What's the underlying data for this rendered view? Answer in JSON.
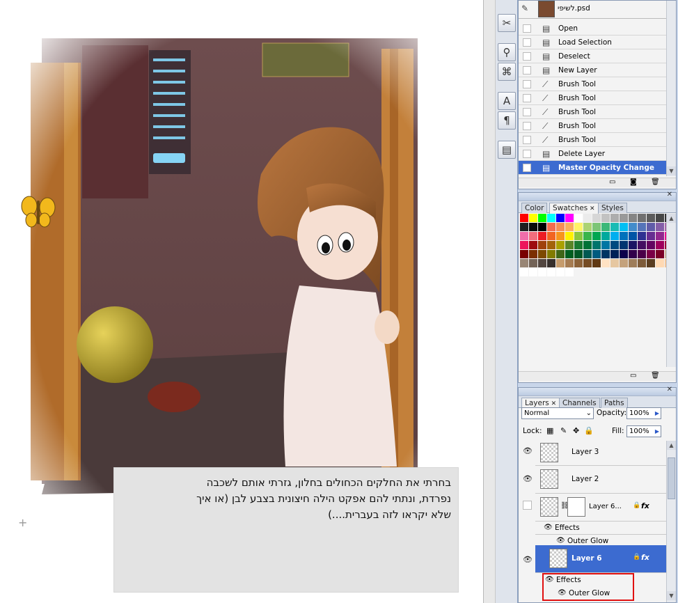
{
  "caption": {
    "line1": "בחרתי את החלקים הכחולים בחלון, גזרתי אותם לשכבה",
    "line2": "נפרדת, ונתתי להם אפקט הילה חיצונית בצבע לבן (או איך",
    "line3": "שלא יקראו לזה בעברית....)"
  },
  "history": {
    "snapshot_label": "לשיפי.psd",
    "items": [
      {
        "label": "Open",
        "icon": "document-icon",
        "selected": false
      },
      {
        "label": "Load Selection",
        "icon": "document-icon",
        "selected": false
      },
      {
        "label": "Deselect",
        "icon": "document-icon",
        "selected": false
      },
      {
        "label": "New Layer",
        "icon": "document-icon",
        "selected": false
      },
      {
        "label": "Brush Tool",
        "icon": "brush-icon",
        "selected": false
      },
      {
        "label": "Brush Tool",
        "icon": "brush-icon",
        "selected": false
      },
      {
        "label": "Brush Tool",
        "icon": "brush-icon",
        "selected": false
      },
      {
        "label": "Brush Tool",
        "icon": "brush-icon",
        "selected": false
      },
      {
        "label": "Brush Tool",
        "icon": "brush-icon",
        "selected": false
      },
      {
        "label": "Delete Layer",
        "icon": "document-icon",
        "selected": false
      },
      {
        "label": "Master Opacity Change",
        "icon": "document-icon",
        "selected": true
      }
    ]
  },
  "color_panel": {
    "tabs": [
      {
        "label": "Color",
        "active": false
      },
      {
        "label": "Swatches",
        "active": true
      },
      {
        "label": "Styles",
        "active": false
      }
    ]
  },
  "swatches": [
    "#ff0000",
    "#ffff00",
    "#00ff00",
    "#00ffff",
    "#0000ff",
    "#ff00ff",
    "#ffffff",
    "#ebebeb",
    "#d6d6d6",
    "#c2c2c2",
    "#adadad",
    "#999999",
    "#858585",
    "#707070",
    "#5c5c5c",
    "#474747",
    "#333333",
    "#1f1f1f",
    "#0a0a0a",
    "#000000",
    "#f26c4f",
    "#f68e56",
    "#fbaf5d",
    "#fff568",
    "#acd372",
    "#7cc576",
    "#3bb878",
    "#1abbb4",
    "#00bff3",
    "#438ccb",
    "#5574b9",
    "#605ca8",
    "#855fa8",
    "#a763a8",
    "#f06eaa",
    "#f26d7d",
    "#ed1c24",
    "#f26522",
    "#f7941d",
    "#fff200",
    "#8dc73f",
    "#39b54a",
    "#00a651",
    "#00a99d",
    "#00aeef",
    "#0072bc",
    "#0054a6",
    "#2e3192",
    "#662d91",
    "#92278f",
    "#ec008c",
    "#ed145b",
    "#9e0b0f",
    "#a0410d",
    "#a3620a",
    "#aba000",
    "#598527",
    "#1a7b30",
    "#007236",
    "#00746b",
    "#0076a3",
    "#004a80",
    "#003471",
    "#1b1464",
    "#440e62",
    "#630460",
    "#9e005d",
    "#9e0039",
    "#790000",
    "#7b2e00",
    "#7d4900",
    "#827b00",
    "#406618",
    "#005e20",
    "#005826",
    "#005952",
    "#005b7f",
    "#003663",
    "#002157",
    "#0d004c",
    "#32004b",
    "#4b0049",
    "#7b0046",
    "#7a0026",
    "#c7b299",
    "#998675",
    "#736357",
    "#534741",
    "#37302d",
    "#c69c6d",
    "#a67c52",
    "#8c6239",
    "#754c24",
    "#603913",
    "#ffe2c3",
    "#e6c7a1",
    "#c4a27c",
    "#9e7d5a",
    "#7d5b3a",
    "#5a3d20",
    "#ffd9b3",
    "#f2c59a",
    "#ffffff",
    "#ffffff",
    "#ffffff",
    "#ffffff",
    "#ffffff",
    "#ffffff"
  ],
  "layers_panel": {
    "tabs": [
      {
        "label": "Layers",
        "active": true
      },
      {
        "label": "Channels",
        "active": false
      },
      {
        "label": "Paths",
        "active": false
      }
    ],
    "blend_mode": "Normal",
    "opacity_label": "Opacity:",
    "opacity_value": "100%",
    "lock_label": "Lock:",
    "fill_label": "Fill:",
    "fill_value": "100%",
    "layers": [
      {
        "name": "Layer 3"
      },
      {
        "name": "Layer 2"
      },
      {
        "name": "Layer 6...",
        "effects": "Effects",
        "effect_item": "Outer Glow"
      },
      {
        "name": "Layer 6",
        "effects": "Effects",
        "effect_item": "Outer Glow"
      }
    ],
    "fx_label": "fx"
  },
  "highlight_color": "#e01010",
  "accent_color": "#3c6bd0"
}
